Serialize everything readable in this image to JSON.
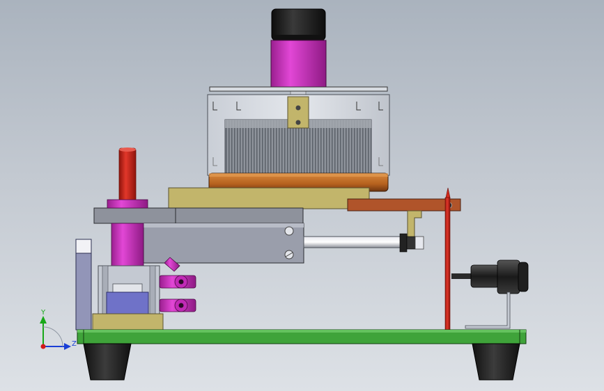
{
  "triad": {
    "y_label": "Y",
    "z_label": "Z"
  },
  "colors": {
    "background_top": "#aab3be",
    "background_bottom": "#dde1e6",
    "base_plate": "#3fa33a",
    "motor_band": "#c733b8",
    "motor_cap": "#1c1c1c",
    "ring_copper": "#b56522",
    "bracket_tan": "#c2b56b",
    "arm_rust": "#b0542a",
    "rod_red": "#d22a1d",
    "cylinder_gray": "#9a9eab",
    "fitting_magenta": "#d633cf",
    "block_blue": "#6f72c8",
    "foot_black": "#262626",
    "axis_y": "#18a818",
    "axis_z": "#1a3fd6",
    "axis_origin": "#d21a1a"
  }
}
